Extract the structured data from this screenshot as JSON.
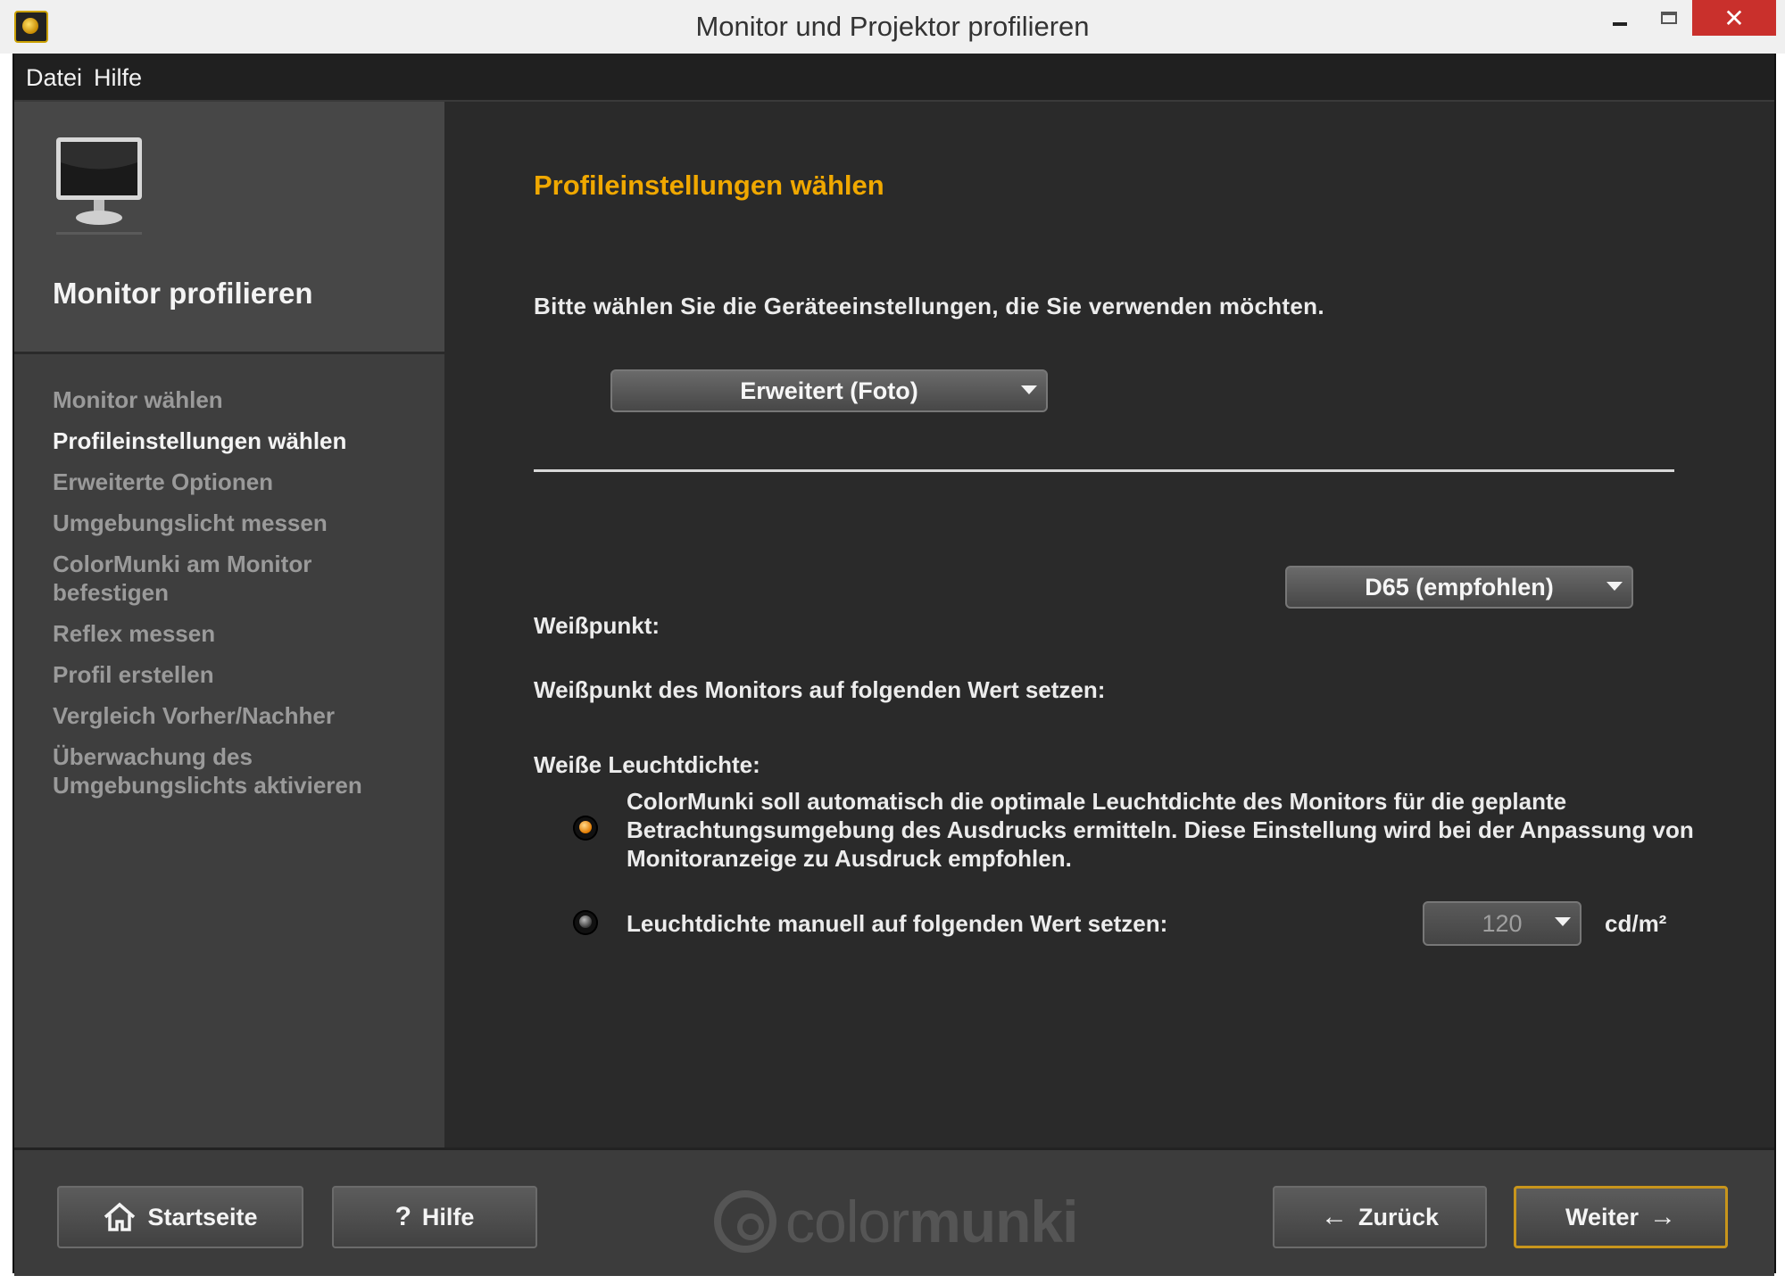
{
  "window": {
    "title": "Monitor und Projektor profilieren",
    "close_glyph": "✕"
  },
  "menu": {
    "items": [
      "Datei",
      "Hilfe"
    ]
  },
  "sidebar": {
    "title": "Monitor profilieren",
    "steps": [
      {
        "label": "Monitor wählen",
        "active": false
      },
      {
        "label": "Profileinstellungen wählen",
        "active": true
      },
      {
        "label": "Erweiterte Optionen",
        "active": false
      },
      {
        "label": "Umgebungslicht messen",
        "active": false
      },
      {
        "label": "ColorMunki am Monitor befestigen",
        "active": false
      },
      {
        "label": "Reflex messen",
        "active": false
      },
      {
        "label": "Profil erstellen",
        "active": false
      },
      {
        "label": "Vergleich Vorher/Nachher",
        "active": false
      },
      {
        "label": "Überwachung des Umgebungslichts aktivieren",
        "active": false
      }
    ]
  },
  "main": {
    "heading": "Profileinstellungen wählen",
    "prompt": "Bitte wählen Sie die Geräteeinstellungen, die Sie verwenden möchten.",
    "mode_select": "Erweitert (Foto)",
    "whitepoint": {
      "section_label": "Weißpunkt:",
      "row_label": "Weißpunkt des Monitors auf folgenden Wert setzen:",
      "value": "D65 (empfohlen)"
    },
    "luminance": {
      "section_label": "Weiße Leuchtdichte:",
      "auto_text": "ColorMunki soll automatisch die optimale Leuchtdichte des Monitors für die geplante Betrachtungsumgebung des Ausdrucks ermitteln. Diese Einstellung wird bei der Anpassung von Monitoranzeige zu Ausdruck empfohlen.",
      "auto_selected": true,
      "manual_label": "Leuchtdichte manuell auf folgenden Wert setzen:",
      "manual_value": "120",
      "unit": "cd/m²"
    }
  },
  "footer": {
    "home": "Startseite",
    "help": "Hilfe",
    "back": "Zurück",
    "next": "Weiter",
    "logo_light": "color",
    "logo_bold": "munki"
  },
  "colors": {
    "accent": "#f0a800",
    "close": "#c9302c"
  }
}
